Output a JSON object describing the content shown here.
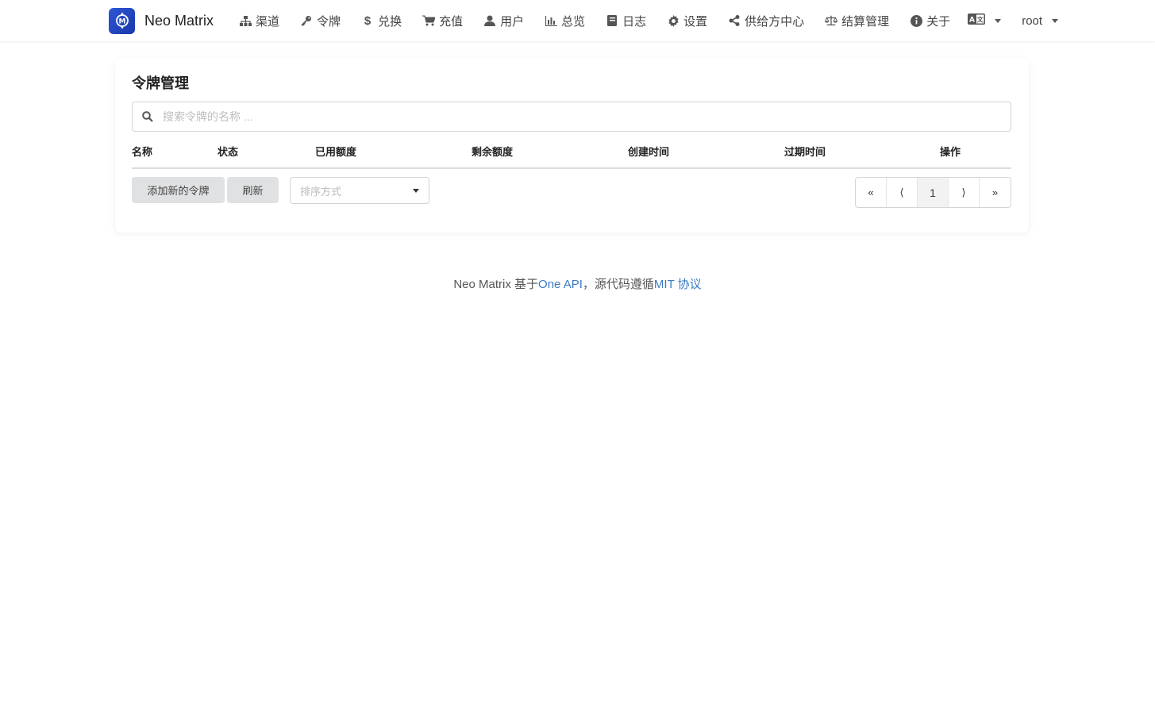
{
  "header": {
    "brand": "Neo Matrix",
    "nav": [
      {
        "id": "channel",
        "label": "渠道",
        "icon": "sitemap-icon"
      },
      {
        "id": "token",
        "label": "令牌",
        "icon": "key-icon"
      },
      {
        "id": "redeem",
        "label": "兑换",
        "icon": "dollar-icon"
      },
      {
        "id": "topup",
        "label": "充值",
        "icon": "cart-icon"
      },
      {
        "id": "user",
        "label": "用户",
        "icon": "user-icon"
      },
      {
        "id": "dashboard",
        "label": "总览",
        "icon": "bar-chart-icon"
      },
      {
        "id": "log",
        "label": "日志",
        "icon": "book-icon"
      },
      {
        "id": "setting",
        "label": "设置",
        "icon": "gear-icon"
      },
      {
        "id": "provider",
        "label": "供给方中心",
        "icon": "share-icon"
      },
      {
        "id": "settlement",
        "label": "结算管理",
        "icon": "balance-scale-icon"
      },
      {
        "id": "about",
        "label": "关于",
        "icon": "info-icon"
      }
    ],
    "user": "root"
  },
  "main": {
    "title": "令牌管理",
    "search_placeholder": "搜索令牌的名称 ...",
    "columns": [
      "名称",
      "状态",
      "已用额度",
      "剩余额度",
      "创建时间",
      "过期时间",
      "操作"
    ],
    "add_button": "添加新的令牌",
    "refresh_button": "刷新",
    "sort_placeholder": "排序方式",
    "pagination": {
      "first": "«",
      "prev": "⟨",
      "current": "1",
      "next": "⟩",
      "last": "»"
    }
  },
  "footer": {
    "prefix": "Neo Matrix 基于",
    "link1": "One API",
    "middle": "，源代码遵循",
    "link2": "MIT 协议"
  }
}
